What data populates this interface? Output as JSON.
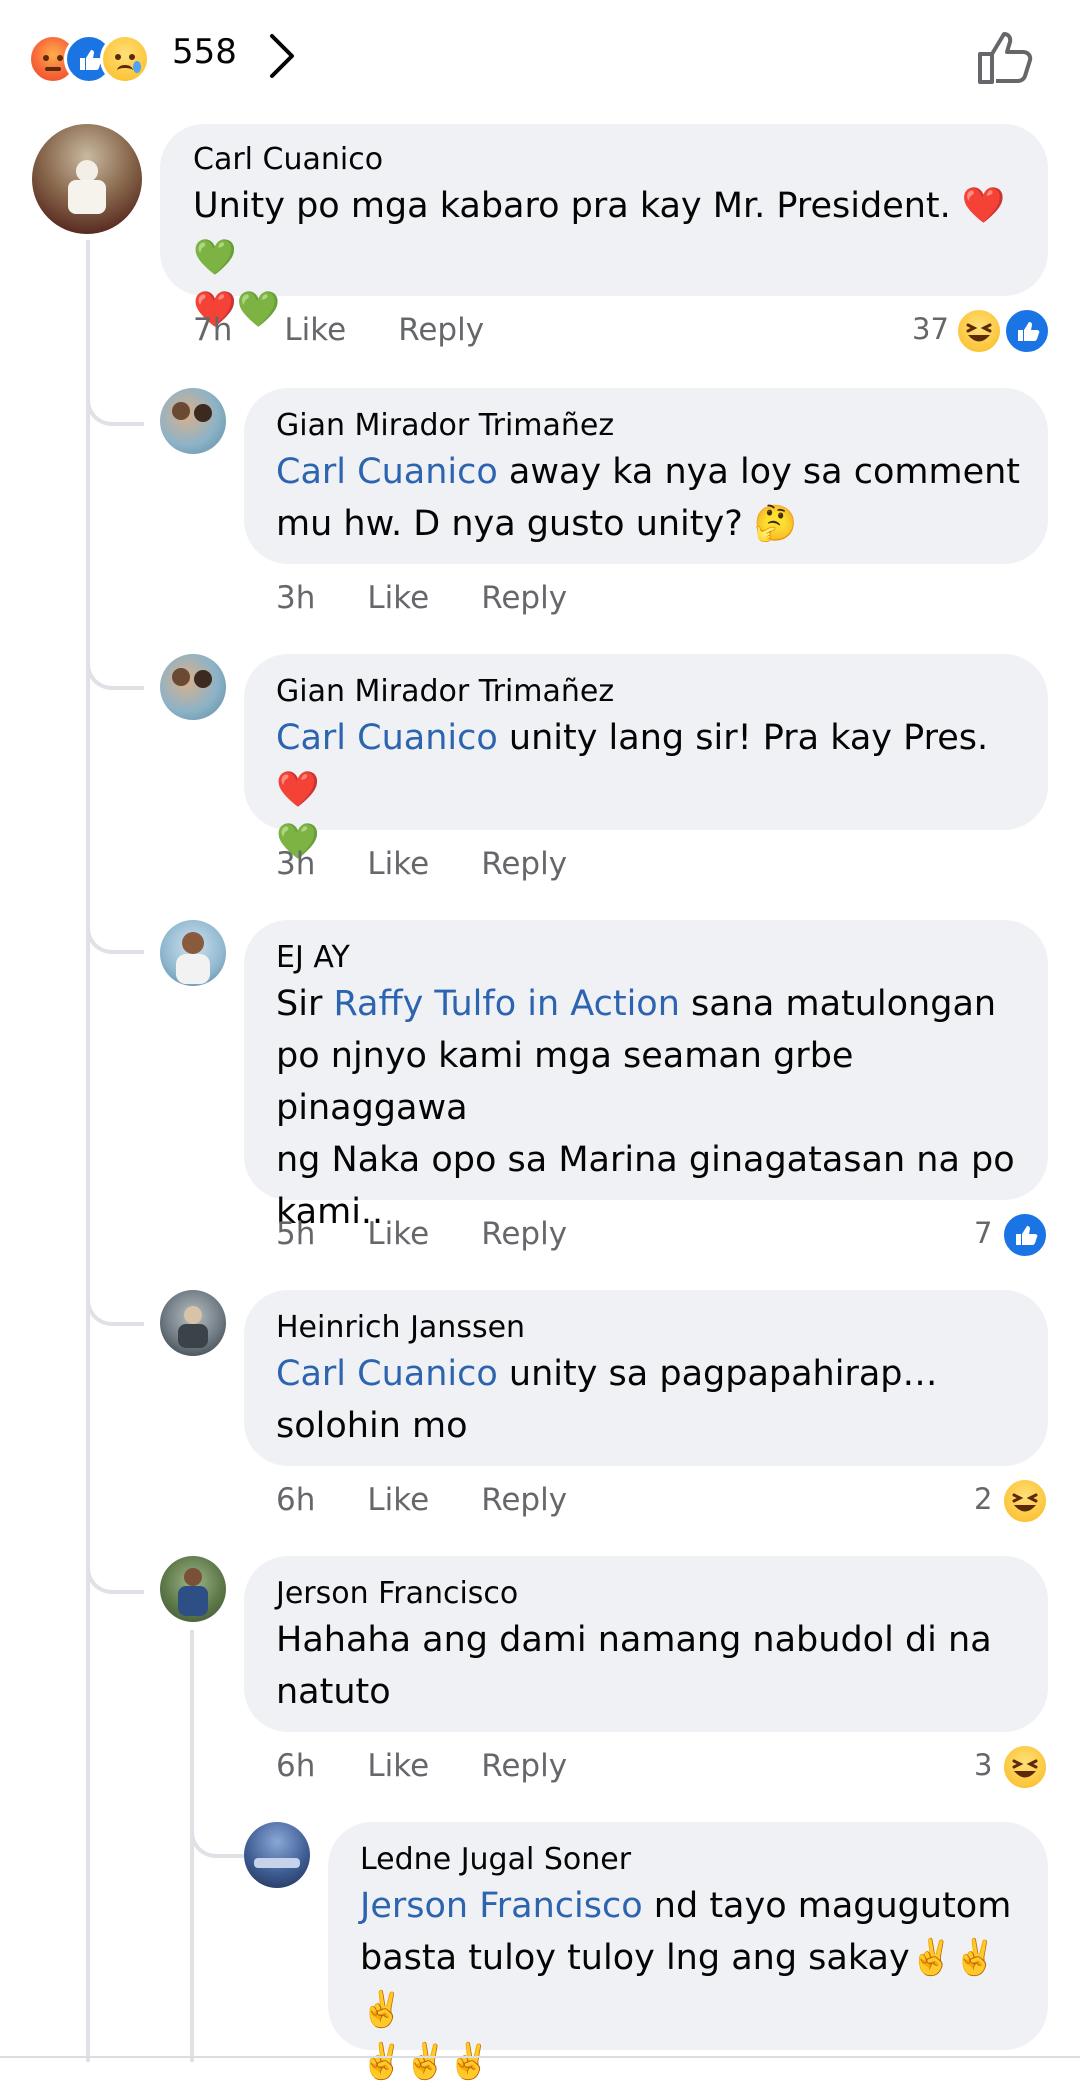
{
  "reactions_bar": {
    "total": "558",
    "icons": [
      "angry-icon",
      "like-icon",
      "sad-icon"
    ]
  },
  "colors": {
    "mention": "#2c64b0",
    "bubble": "#f0f1f5",
    "meta": "#65676b",
    "like_blue": "#1b74e4"
  },
  "comments": [
    {
      "author": "Carl Cuanico",
      "text_lines": [
        "Unity po mga kabaro pra kay Mr. President. ❤️💚",
        "❤️💚"
      ],
      "time": "7h",
      "like_label": "Like",
      "reply_label": "Reply",
      "reaction_count": "37",
      "reaction_icons": [
        "haha-icon",
        "like-icon"
      ]
    },
    {
      "author": "Gian Mirador Trimañez",
      "mention": "Carl Cuanico",
      "text_lines": [
        " away ka nya loy sa comment",
        "mu hw. D nya gusto unity? 🤔"
      ],
      "time": "3h",
      "like_label": "Like",
      "reply_label": "Reply"
    },
    {
      "author": "Gian Mirador Trimañez",
      "mention": "Carl Cuanico",
      "text_lines": [
        " unity lang sir! Pra kay Pres. ❤️",
        "💚"
      ],
      "time": "3h",
      "like_label": "Like",
      "reply_label": "Reply"
    },
    {
      "author": "EJ AY",
      "prefix": "Sir ",
      "mention": "Raffy Tulfo in Action",
      "text_lines": [
        " sana matulongan",
        "po njnyo kami mga seaman grbe pinaggawa",
        "ng Naka opo sa Marina ginagatasan na po",
        "kami.."
      ],
      "time": "5h",
      "like_label": "Like",
      "reply_label": "Reply",
      "reaction_count": "7",
      "reaction_icons": [
        "like-icon"
      ]
    },
    {
      "author": "Heinrich Janssen",
      "mention": "Carl Cuanico",
      "text_lines": [
        " unity sa pagpapahirap…",
        "solohin mo"
      ],
      "time": "6h",
      "like_label": "Like",
      "reply_label": "Reply",
      "reaction_count": "2",
      "reaction_icons": [
        "haha-icon"
      ]
    },
    {
      "author": "Jerson Francisco",
      "text_lines": [
        "Hahaha ang dami namang nabudol di na",
        "natuto"
      ],
      "time": "6h",
      "like_label": "Like",
      "reply_label": "Reply",
      "reaction_count": "3",
      "reaction_icons": [
        "haha-icon"
      ]
    },
    {
      "author": "Ledne Jugal Soner",
      "mention": "Jerson Francisco",
      "text_lines": [
        " nd tayo magugutom",
        "basta tuloy tuloy lng ang sakay✌️✌️✌️",
        "✌️✌️✌️"
      ]
    }
  ]
}
